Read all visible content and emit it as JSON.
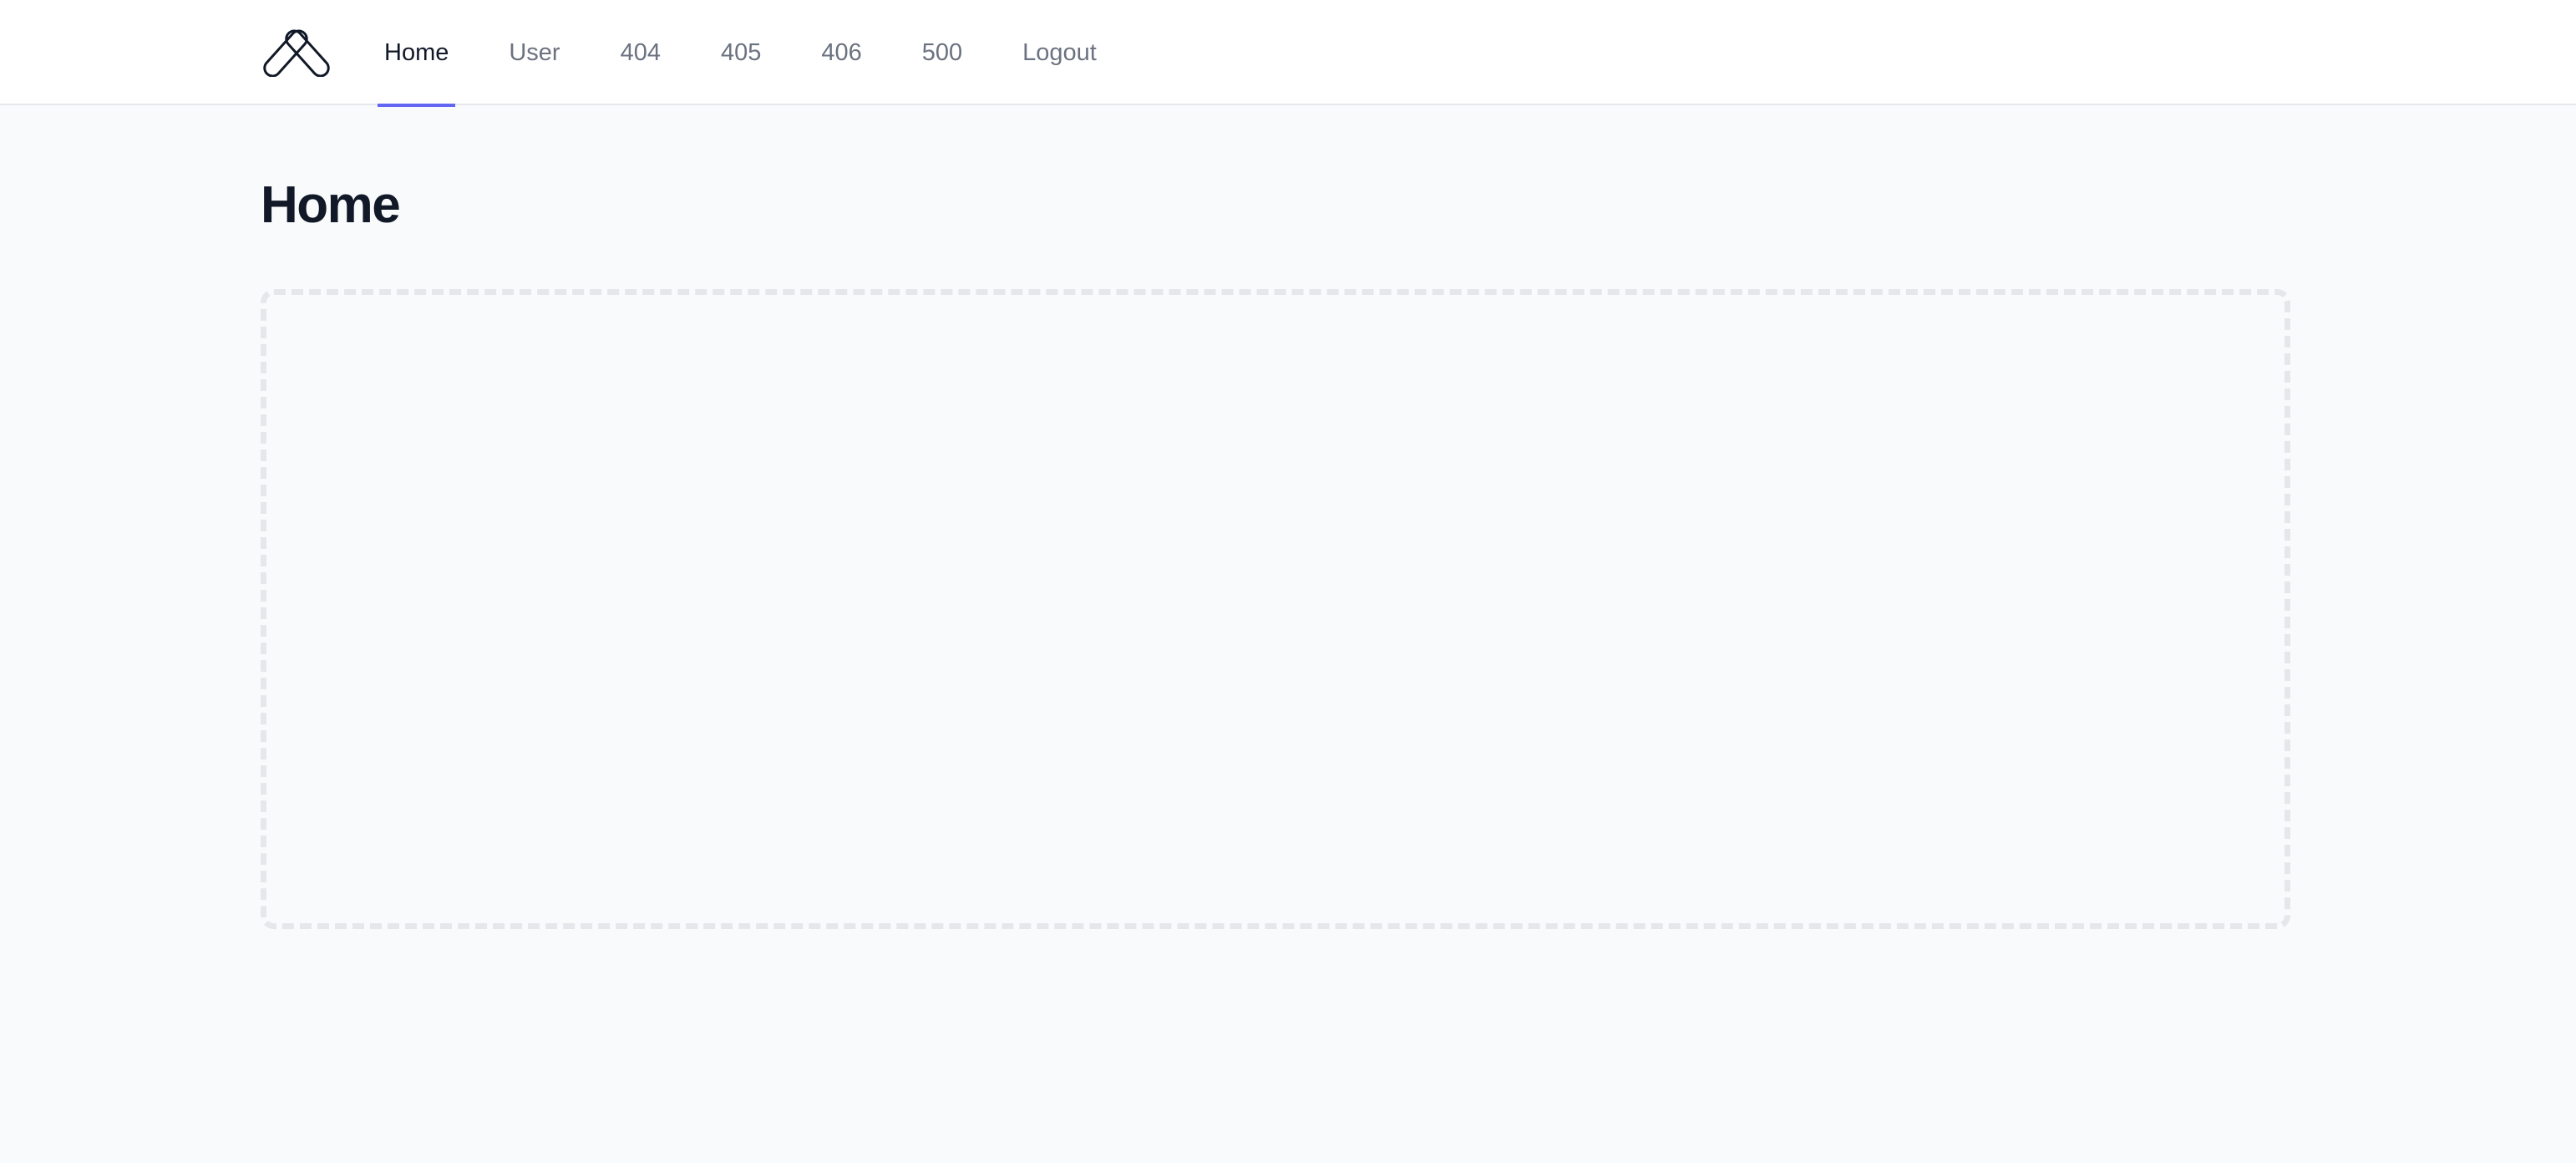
{
  "nav": {
    "items": [
      {
        "label": "Home",
        "active": true
      },
      {
        "label": "User",
        "active": false
      },
      {
        "label": "404",
        "active": false
      },
      {
        "label": "405",
        "active": false
      },
      {
        "label": "406",
        "active": false
      },
      {
        "label": "500",
        "active": false
      },
      {
        "label": "Logout",
        "active": false
      }
    ]
  },
  "page": {
    "title": "Home"
  },
  "colors": {
    "accent": "#6366f1",
    "background": "#f9fafb",
    "header_bg": "#ffffff",
    "text_primary": "#111827",
    "text_secondary": "#6b7280",
    "border": "#e5e7eb"
  },
  "icons": {
    "logo": "pill-logo-icon"
  }
}
